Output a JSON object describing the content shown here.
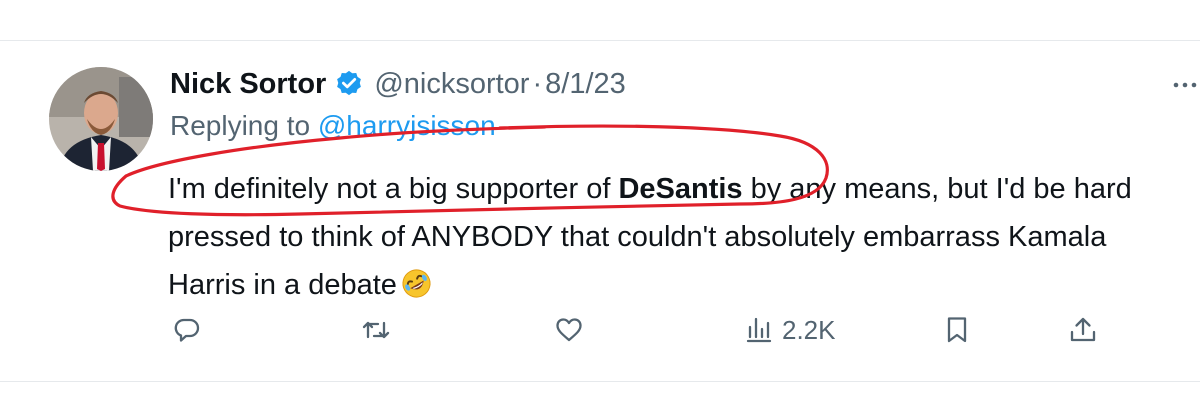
{
  "tweet": {
    "author_name": "Nick Sortor",
    "handle": "@nicksortor",
    "separator": "·",
    "date": "8/1/23",
    "replying_prefix": "Replying to ",
    "replying_to": "@harryjsisson",
    "text_before_bold": "I'm definitely not a big supporter of ",
    "text_bold": "DeSantis",
    "text_after_bold": " by any means, but I'd be hard pressed to think of ANYBODY that couldn't absolutely embarrass Kamala Harris in a debate",
    "emoji": "rolling-on-the-floor-laughing",
    "views_count": "2.2K"
  },
  "icons": {
    "verified": "verified-badge-icon",
    "more": "more-options-icon",
    "reply": "reply-icon",
    "retweet": "retweet-icon",
    "like": "like-icon",
    "views": "views-icon",
    "bookmark": "bookmark-icon",
    "share": "share-icon"
  },
  "colors": {
    "text": "#0f1419",
    "secondary": "#536471",
    "link": "#1d9bf0",
    "verified": "#1d9bf0",
    "annotation": "#e0202a"
  }
}
